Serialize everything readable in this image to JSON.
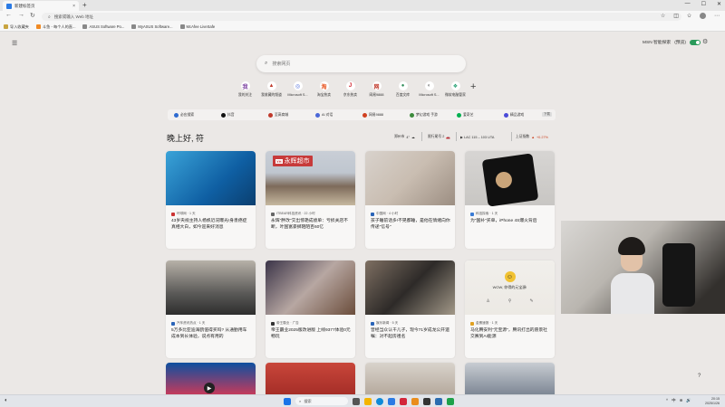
{
  "browser": {
    "tab_title": "新建标签页",
    "tab_close": "×",
    "new_tab": "+",
    "window_controls": [
      "—",
      "☐",
      "✕"
    ],
    "address_placeholder": "搜索或输入 Web 地址",
    "bookmarks": [
      {
        "label": "导入收藏夹",
        "icon": "folder-icon"
      },
      {
        "label": "斗鱼 - 每个人的直...",
        "icon": "douyu-icon"
      },
      {
        "label": "ASUS Software Po...",
        "icon": "asus-icon"
      },
      {
        "label": "MyASUS Software...",
        "icon": "asus-icon"
      },
      {
        "label": "McAfee LiveSafe",
        "icon": "mcafee-icon"
      }
    ]
  },
  "page": {
    "msn_label": "MSN 智能探索",
    "msn_badge": "(预览)",
    "search_placeholder": "搜索网页",
    "shortcuts": [
      {
        "label": "我的关注",
        "icon": "我",
        "color": "#7b3fa0"
      },
      {
        "label": "我收藏的频道",
        "icon": "▲",
        "color": "#c0392b"
      },
      {
        "label": "Microsoft S...",
        "icon": "◎",
        "color": "#4a67d8"
      },
      {
        "label": "淘宝热卖",
        "icon": "淘",
        "color": "#e8531f"
      },
      {
        "label": "京东热卖",
        "icon": "J",
        "color": "#d0202a"
      },
      {
        "label": "网易9888",
        "icon": "网",
        "color": "#c0392b"
      },
      {
        "label": "百度文库",
        "icon": "●",
        "color": "#2e8b57"
      },
      {
        "label": "Microsoft S...",
        "icon": "◐",
        "color": "#777777"
      },
      {
        "label": "微软电脑管家",
        "icon": "❖",
        "color": "#1f9e6e"
      }
    ],
    "add_shortcut": "+",
    "quick_links": [
      {
        "label": "必应搜索",
        "color": "#2e6ad0"
      },
      {
        "label": "抖音",
        "color": "#111111"
      },
      {
        "label": "至高商城",
        "color": "#c0392b"
      },
      {
        "label": "AI 对话",
        "color": "#4a67d8"
      },
      {
        "label": "网易9888",
        "color": "#d04020"
      },
      {
        "label": "梦幻游戏 手游",
        "color": "#3c8b3c"
      },
      {
        "label": "爱奇艺",
        "color": "#00b050"
      },
      {
        "label": "精品游戏",
        "color": "#4a4ad8"
      }
    ],
    "quick_more": "下载",
    "greeting": "晚上好, 符",
    "weather": {
      "city": "郑州市",
      "temp": "4°"
    },
    "traffic": "限行尾号 2",
    "sports": "▶ LAC 115 – 103 UTA",
    "stock_label": "上证指数",
    "stock_change": "+0.27%",
    "help_icon": "?"
  },
  "cards": [
    {
      "source": "环球网 · 1 天",
      "headline": "43岁央视主持人杨帆近况曝光!身患癌症真相大白，如今迎来好消息",
      "image": "news-anchor-photo"
    },
    {
      "source": "ITBEAR科技资讯 · 22 小时",
      "headline": "永辉\"胖改\"交出惊艳成绩单：亏损关店不断，叶国富豪掷陌陌百60亿",
      "image": "supermarket-photo",
      "tag": "永辉超市",
      "tag_badge": "YH"
    },
    {
      "source": "中国网 · 4 小时",
      "headline": "孩子睡前话多!不晃都睡，是他在情绪向你传递\"信号\"",
      "image": "child-photo"
    },
    {
      "source": "科技探索 · 1 天",
      "headline": "为\"国补\"买单，iPhone 4S爆火背后",
      "image": "iphone-photo"
    },
    {
      "source": "汽车资讯热点 · 1 天",
      "headline": "5万多比亚迪海鸥值得买吗? 从通勤用车成本到长体验，说点有用的",
      "image": "car-interior-photo"
    },
    {
      "source": "帝王霸业 · 广告",
      "headline": "帝王霸业2025版改进版 上线9377体验0元畅玩",
      "image": "game-ad-photo",
      "is_ad": true
    },
    {
      "source": "娱乐新闻 · 5 天",
      "headline": "曾经当众认干儿子，现今71岁成龙公开遗嘱：对不起房祖名",
      "image": "jackie-chan-photo"
    },
    {
      "source": "金蛋速报 · 1 天",
      "headline": "马化腾安利\"元宝源\"，腾讯打出的愿景社交赛到AI能源",
      "image": "wow-prompt",
      "wow_text": "WOW, 你得的元宝源!"
    },
    {
      "source": "",
      "headline": "",
      "image": "concert-photo",
      "video": true
    },
    {
      "source": "",
      "headline": "",
      "image": "goji-photo"
    },
    {
      "source": "",
      "headline": "",
      "image": "man-photo"
    },
    {
      "source": "",
      "headline": "",
      "image": "car-show-photo"
    }
  ],
  "taskbar": {
    "search_placeholder": "搜索",
    "time": "20:15",
    "date": "2025/1/26",
    "tray": [
      "^",
      "中",
      "⊕",
      "🔊"
    ]
  }
}
